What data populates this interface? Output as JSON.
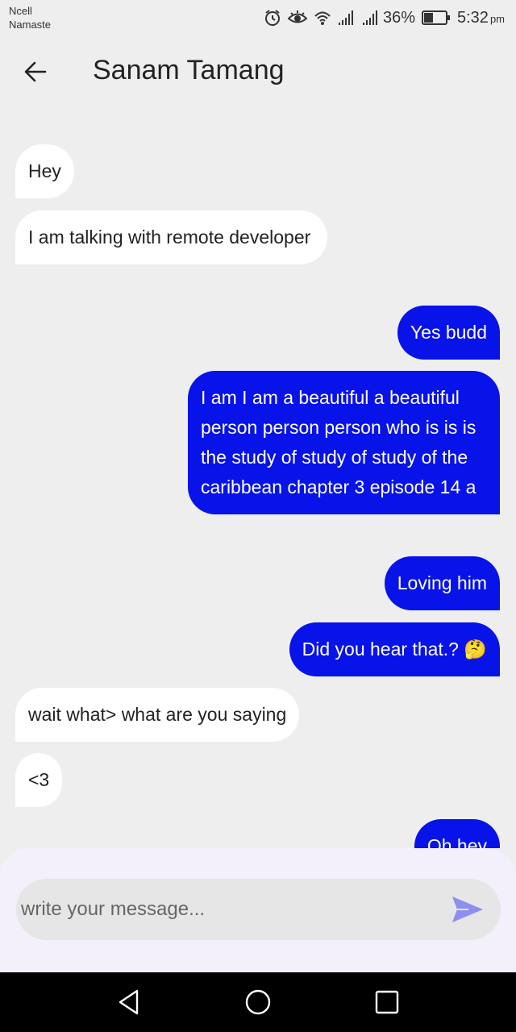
{
  "status_bar": {
    "carrier_line1": "Ncell",
    "carrier_line2": "Namaste",
    "battery": "36%",
    "time": "5:32",
    "time_suffix": "pm",
    "icons": [
      "alarm-icon",
      "eye-icon",
      "wifi-icon",
      "signal-icon",
      "signal-icon",
      "battery-icon"
    ]
  },
  "header": {
    "back_icon": "arrow-left-icon",
    "title": "Sanam Tamang"
  },
  "messages": [
    {
      "direction": "incoming",
      "text": "Hey"
    },
    {
      "direction": "incoming",
      "text": "I am talking with remote developer"
    },
    {
      "direction": "outgoing",
      "text": "Yes budd"
    },
    {
      "direction": "outgoing",
      "text": "I am I am a beautiful a beautiful person person person who is is is the study of study of study of the caribbean chapter 3 episode 14 a"
    },
    {
      "direction": "outgoing",
      "text": "Loving him"
    },
    {
      "direction": "outgoing",
      "text": "Did you hear that.? 🤔"
    },
    {
      "direction": "incoming",
      "text": "wait what> what are you saying"
    },
    {
      "direction": "incoming",
      "text": "<3"
    },
    {
      "direction": "outgoing",
      "text": "Oh hey"
    }
  ],
  "composer": {
    "placeholder": "write your message...",
    "send_icon": "send-icon"
  },
  "nav_bar": {
    "icons": [
      "back-triangle-icon",
      "home-circle-icon",
      "recents-square-icon"
    ]
  },
  "colors": {
    "background": "#eeeeee",
    "outgoing_bubble": "#0713e8",
    "incoming_bubble": "#ffffff",
    "composer_bg": "#f3f0fc",
    "send_icon": "#8c8ef0"
  }
}
